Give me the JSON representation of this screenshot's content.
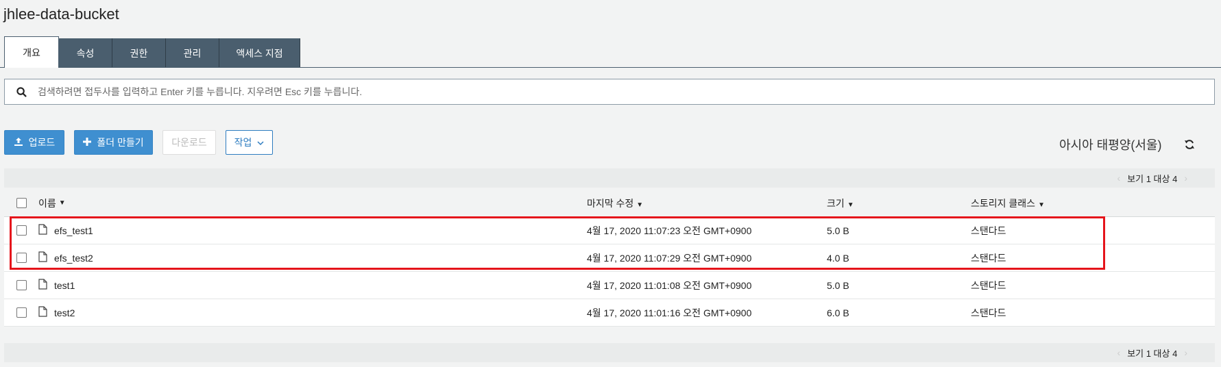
{
  "bucket_title": "jhlee-data-bucket",
  "tabs": [
    {
      "label": "개요",
      "active": true
    },
    {
      "label": "속성"
    },
    {
      "label": "권한"
    },
    {
      "label": "관리"
    },
    {
      "label": "액세스 지점"
    }
  ],
  "search": {
    "placeholder": "검색하려면 접두사를 입력하고 Enter 키를 누릅니다. 지우려면 Esc 키를 누릅니다."
  },
  "toolbar": {
    "upload_label": "업로드",
    "create_folder_label": "폴더 만들기",
    "download_label": "다운로드",
    "actions_label": "작업"
  },
  "region": "아시아 태평양(서울)",
  "pager": {
    "label": "보기 1 대상 4"
  },
  "table": {
    "headers": {
      "name": "이름",
      "modified": "마지막 수정",
      "size": "크기",
      "storage_class": "스토리지 클래스"
    },
    "rows": [
      {
        "name": "efs_test1",
        "modified": "4월 17, 2020 11:07:23 오전 GMT+0900",
        "size": "5.0 B",
        "storage_class": "스탠다드"
      },
      {
        "name": "efs_test2",
        "modified": "4월 17, 2020 11:07:29 오전 GMT+0900",
        "size": "4.0 B",
        "storage_class": "스탠다드"
      },
      {
        "name": "test1",
        "modified": "4월 17, 2020 11:01:08 오전 GMT+0900",
        "size": "5.0 B",
        "storage_class": "스탠다드"
      },
      {
        "name": "test2",
        "modified": "4월 17, 2020 11:01:16 오전 GMT+0900",
        "size": "6.0 B",
        "storage_class": "스탠다드"
      }
    ]
  },
  "colors": {
    "primary": "#3f8fd0",
    "tab_bg": "#4a5e6e",
    "highlight": "#e5141b"
  }
}
